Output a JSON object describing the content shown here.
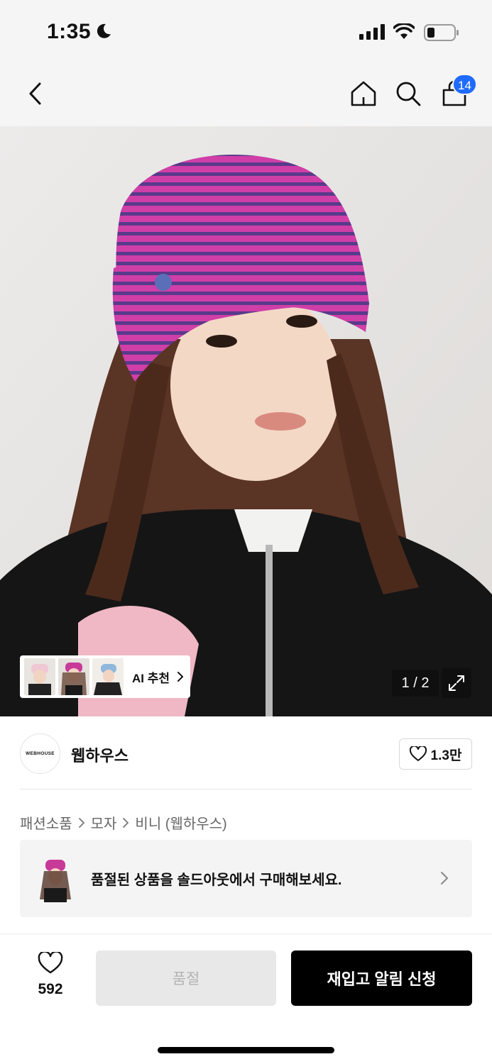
{
  "status_bar": {
    "time": "1:35",
    "icons": [
      "moon-icon",
      "signal-icon",
      "wifi-icon",
      "battery-icon"
    ]
  },
  "nav": {
    "back_icon": "chevron-left-icon",
    "home_icon": "home-icon",
    "search_icon": "search-icon",
    "cart_icon": "shopping-bag-icon",
    "cart_count": "14",
    "badge_color": "#1f6bff"
  },
  "hero": {
    "pager": "1 / 2",
    "expand_icon": "expand-icon",
    "ai_recommend_label": "AI 추천"
  },
  "brand": {
    "logo_text": "WEBHOUSE",
    "name": "웹하우스",
    "like_count": "1.3만"
  },
  "breadcrumb": [
    "패션소품",
    "모자",
    "비니 (웹하우스)"
  ],
  "soldout_banner": {
    "text": "품절된 상품을 솔드아웃에서 구매해보세요."
  },
  "bottom_bar": {
    "wish_count": "592",
    "soldout_label": "품절",
    "restock_label": "재입고 알림 신청"
  }
}
